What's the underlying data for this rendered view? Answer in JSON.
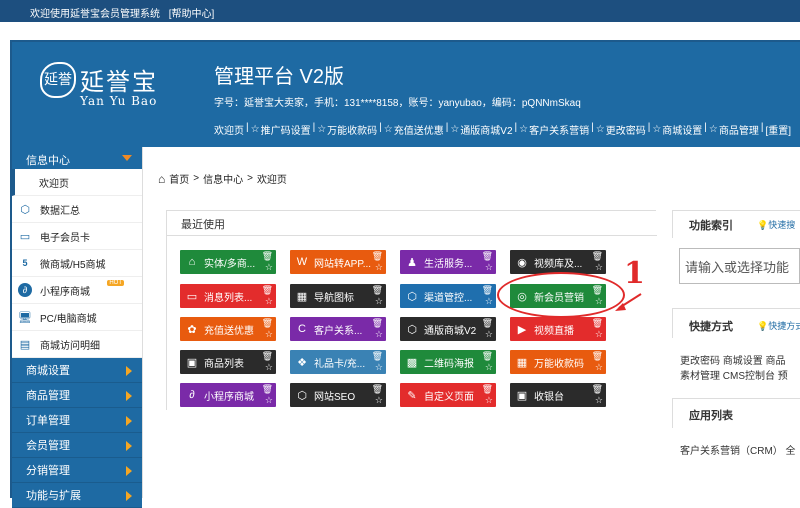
{
  "topbar": {
    "welcome": "欢迎使用延誉宝会员管理系统",
    "help": "[帮助中心]"
  },
  "logo": {
    "seal": "延誉",
    "cn": "延誉宝",
    "en": "Yan Yu Bao"
  },
  "header": {
    "title": "管理平台 V2版",
    "info": "字号：延誉宝大卖家，手机：131****8158，账号：yanyubao，编码：pQNNmSkaq",
    "nav": [
      "欢迎页",
      "推广码设置",
      "万能收款码",
      "充值送优惠",
      "通版商城V2",
      "客户关系营销",
      "更改密码",
      "商城设置",
      "商品管理",
      "[重置]"
    ]
  },
  "sidebar": {
    "header": "信息中心",
    "items": [
      {
        "label": "欢迎页",
        "icon": "none"
      },
      {
        "label": "数据汇总",
        "icon": "cube-icon"
      },
      {
        "label": "电子会员卡",
        "icon": "card-icon"
      },
      {
        "label": "微商城/H5商城",
        "icon": "html5-icon"
      },
      {
        "label": "小程序商城",
        "icon": "miniprogram-icon",
        "badge": "HOT"
      },
      {
        "label": "PC/电脑商城",
        "icon": "desktop-icon"
      },
      {
        "label": "商城访问明细",
        "icon": "list-icon"
      }
    ],
    "sections": [
      "商城设置",
      "商品管理",
      "订单管理",
      "会员管理",
      "分销管理",
      "功能与扩展"
    ]
  },
  "breadcrumb": {
    "home": "首页",
    "level1": "信息中心",
    "level2": "欢迎页",
    "sep": ">"
  },
  "recent": {
    "title": "最近使用",
    "tiles": [
      {
        "label": "实体/多商...",
        "color": "#1f8a3b",
        "icon": "store-icon"
      },
      {
        "label": "网站转APP...",
        "color": "#e85b0f",
        "icon": "wordpress-icon"
      },
      {
        "label": "生活服务...",
        "color": "#7a2aa8",
        "icon": "service-icon"
      },
      {
        "label": "视频库及...",
        "color": "#2b2b2b",
        "icon": "film-icon"
      },
      {
        "label": "消息列表...",
        "color": "#e32c2c",
        "icon": "chat-icon"
      },
      {
        "label": "导航图标",
        "color": "#2b2b2b",
        "icon": "apps-icon"
      },
      {
        "label": "渠道管控...",
        "color": "#1f6fae",
        "icon": "box-icon"
      },
      {
        "label": "新会员营销",
        "color": "#1f8a3b",
        "icon": "target-icon"
      },
      {
        "label": "充值送优惠",
        "color": "#e85b0f",
        "icon": "gift-icon"
      },
      {
        "label": "客户关系...",
        "color": "#7a2aa8",
        "icon": "crm-icon"
      },
      {
        "label": "通版商城V2",
        "color": "#2b2b2b",
        "icon": "cube-icon"
      },
      {
        "label": "视频直播",
        "color": "#e32c2c",
        "icon": "camera-icon"
      },
      {
        "label": "商品列表",
        "color": "#2b2b2b",
        "icon": "inbox-icon"
      },
      {
        "label": "礼品卡/充...",
        "color": "#3a82b4",
        "icon": "giftcard-icon"
      },
      {
        "label": "二维码海报",
        "color": "#1f8a3b",
        "icon": "qrcode-icon"
      },
      {
        "label": "万能收款码",
        "color": "#e85b0f",
        "icon": "payment-icon"
      },
      {
        "label": "小程序商城",
        "color": "#7a2aa8",
        "icon": "miniprogram-icon"
      },
      {
        "label": "网站SEO",
        "color": "#2b2b2b",
        "icon": "cube-icon"
      },
      {
        "label": "自定义页面",
        "color": "#e32c2c",
        "icon": "edit-icon"
      },
      {
        "label": "收银台",
        "color": "#2b2b2b",
        "icon": "register-icon"
      }
    ]
  },
  "annotation": {
    "number": "1"
  },
  "right": {
    "func_title": "功能索引",
    "func_search": "快速搜",
    "search_placeholder": "请输入或选择功能",
    "quick_title": "快捷方式",
    "quick_set": "快捷方式",
    "quick_links_1": "更改密码  商城设置  商品",
    "quick_links_2": "素材管理  CMS控制台  预",
    "app_title": "应用列表",
    "app_links": "客户关系营销（CRM）   全"
  }
}
